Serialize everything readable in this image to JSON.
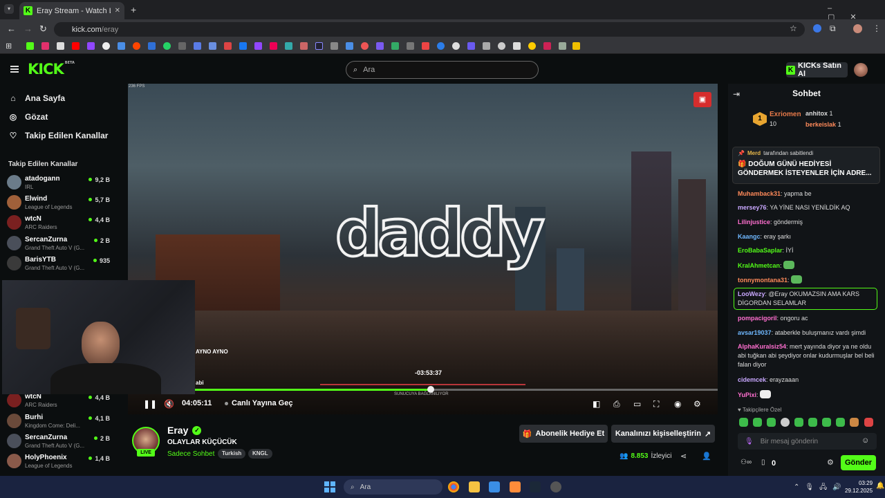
{
  "browser": {
    "tab_title": "Eray Stream - Watch Live on Kick",
    "url_host": "kick.com",
    "url_path": "/eray"
  },
  "header": {
    "logo": "KICK",
    "logo_sup": "BETA",
    "search_placeholder": "Ara",
    "buy_kicks": "KICKs Satın Al"
  },
  "sidebar": {
    "nav": [
      {
        "label": "Ana Sayfa",
        "icon": "home-icon"
      },
      {
        "label": "Gözat",
        "icon": "compass-icon"
      },
      {
        "label": "Takip Edilen Kanallar",
        "icon": "heart-icon"
      }
    ],
    "following_header": "Takip Edilen Kanallar",
    "channels_top": [
      {
        "name": "atadogann",
        "category": "IRL",
        "viewers": "9,2 B"
      },
      {
        "name": "Elwind",
        "category": "League of Legends",
        "viewers": "5,7 B"
      },
      {
        "name": "wtcN",
        "category": "ARC Raiders",
        "viewers": "4,4 B"
      },
      {
        "name": "SercanZurna",
        "category": "Grand Theft Auto V (G...",
        "viewers": "2 B"
      },
      {
        "name": "BarisYTB",
        "category": "Grand Theft Auto V (G...",
        "viewers": "935"
      }
    ],
    "channels_bottom": [
      {
        "name": "wtcN",
        "category": "ARC Raiders",
        "viewers": "4,4 B"
      },
      {
        "name": "Burhi",
        "category": "Kingdom Come: Deli...",
        "viewers": "4,1 B"
      },
      {
        "name": "SercanZurna",
        "category": "Grand Theft Auto V (G...",
        "viewers": "2 B"
      },
      {
        "name": "HolyPhoenix",
        "category": "League of Legends",
        "viewers": "1,4 B"
      }
    ]
  },
  "player": {
    "fps": "236 FPS",
    "overlay_text": "daddy",
    "seek_tooltip": "-03:53:37",
    "seek_sub": "SUNUCUYA BAĞLANILIYOR",
    "progress": 0.51,
    "timecode": "04:05:11",
    "go_live": "Canlı Yayına Geç",
    "chat_overlay": [
      "AYNO AYNO",
      "abi"
    ]
  },
  "stream": {
    "streamer": "Eray",
    "live_badge": "LIVE",
    "title": "OLAYLAR KÜÇÜCÜK",
    "category": "Sadece Sohbet",
    "tags": [
      "Turkish",
      "KNGL"
    ],
    "gift_sub": "Abonelik Hediye Et",
    "customize": "Kanalınızı kişiselleştirin",
    "viewer_count": "8.853",
    "viewer_label": "İzleyici"
  },
  "chat": {
    "title": "Sohbet",
    "leader": {
      "rank": "1",
      "name": "Exriomen",
      "count": "10"
    },
    "leader2": {
      "name": "anhitox",
      "count": "1"
    },
    "leader3": {
      "name": "berkeislak",
      "count": "1"
    },
    "pinned_by": "Merd",
    "pinned_suffix": "tarafından sabitlendi",
    "pinned_msg": "🎁 DOĞUM GÜNÜ HEDİYESİ GÖNDERMEK İSTEYENLER İÇİN ADRE...",
    "messages": [
      {
        "user": "Muhamback31",
        "color": "#ff8a5a",
        "text": "yapma be"
      },
      {
        "user": "mersey76",
        "color": "#c9a8ff",
        "text": "YA YİNE NASI YENİLDİK AQ"
      },
      {
        "user": "Lilinjustice",
        "color": "#ff6fd0",
        "text": "göndermiş"
      },
      {
        "user": "Kaangc",
        "color": "#6fb8ff",
        "text": "eray şarkı"
      },
      {
        "user": "EroBabaSaplar",
        "color": "#53fc18",
        "text": "İYİ"
      },
      {
        "user": "KralAhmetcan",
        "color": "#53fc18",
        "text": ""
      },
      {
        "user": "tonnymontana31",
        "color": "#ff8a5a",
        "text": ""
      },
      {
        "user": "LooWezy",
        "color": "#c9a8ff",
        "text": "@Eray OKUMAZSIN AMA KARS DİGORDAN SELAMLAR"
      },
      {
        "user": "pompacigoril",
        "color": "#ff6fd0",
        "text": "ongoru ac"
      },
      {
        "user": "avsar19037",
        "color": "#6fb8ff",
        "text": "ataberkle buluşmanız vardı şimdi"
      },
      {
        "user": "AlphaKuralsiz54",
        "color": "#ff6fd0",
        "text": "mert yayında diyor ya ne oldu abi tuğkan abi şeydiyor onlar kudurmuşlar bel beli falan diyor"
      },
      {
        "user": "cidemcek",
        "color": "#c9a8ff",
        "text": "erayzaaan"
      },
      {
        "user": "YuPixi",
        "color": "#ff6fd0",
        "text": ""
      }
    ],
    "follower_only": "Takipçilere Özel",
    "input_placeholder": "Bir mesaj gönderin",
    "points": "0",
    "send": "Gönder"
  },
  "taskbar": {
    "search": "Ara",
    "time": "03:29",
    "date": "29.12.2025"
  }
}
